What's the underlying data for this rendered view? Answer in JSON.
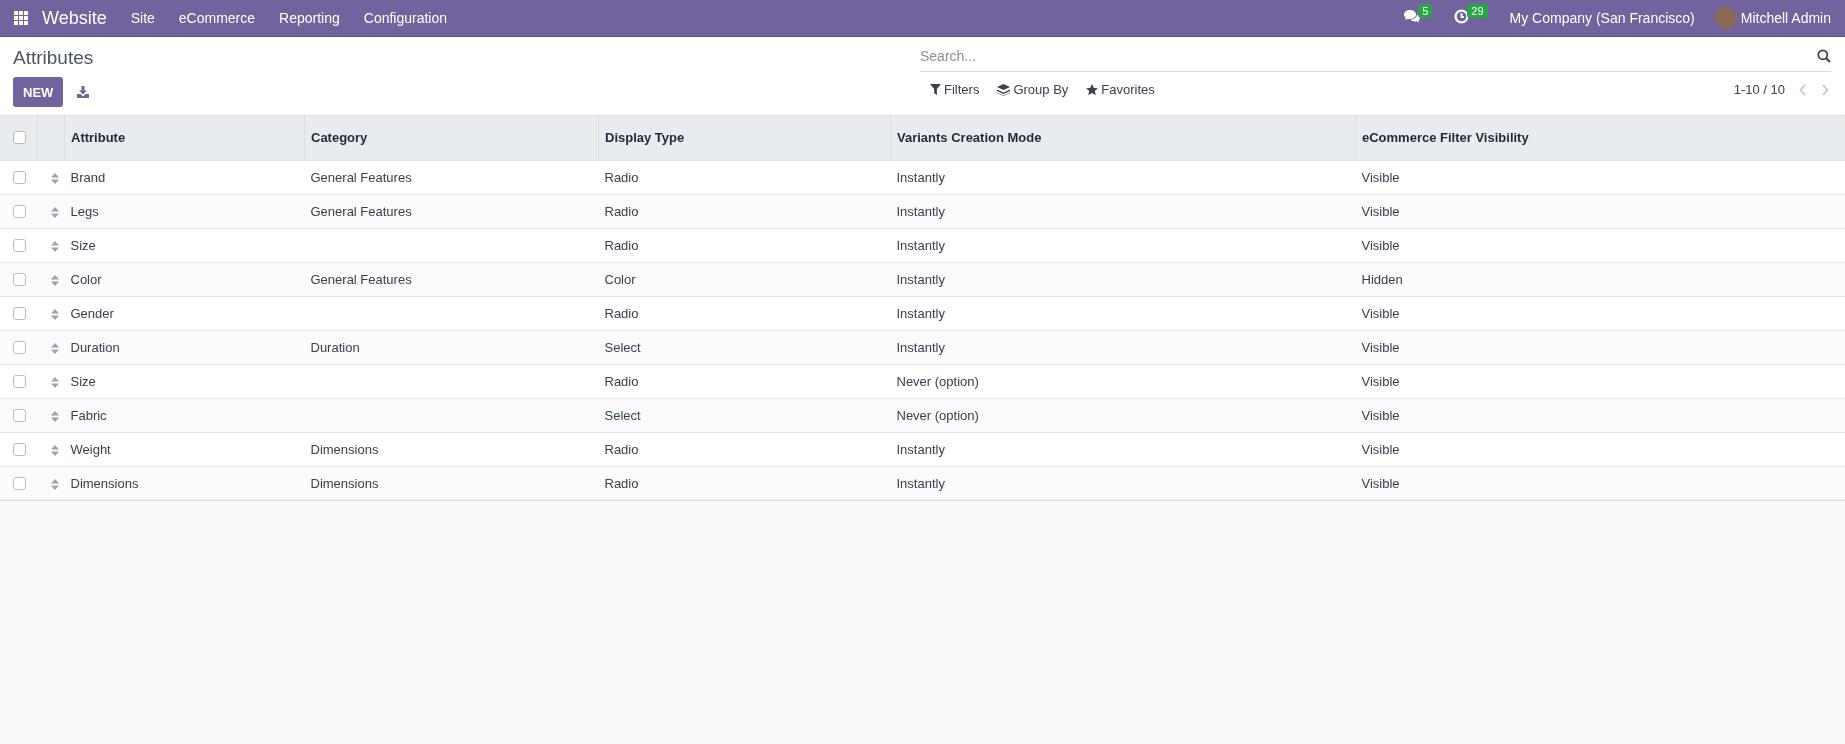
{
  "navbar": {
    "app_name": "Website",
    "menu": [
      "Site",
      "eCommerce",
      "Reporting",
      "Configuration"
    ],
    "messages_count": "5",
    "activities_count": "29",
    "company": "My Company (San Francisco)",
    "user": "Mitchell Admin"
  },
  "control_panel": {
    "title": "Attributes",
    "new_button": "NEW",
    "search": {
      "placeholder": "Search..."
    },
    "filters": [
      {
        "kind": "filter",
        "label": "Filters"
      },
      {
        "kind": "group",
        "label": "Group By"
      },
      {
        "kind": "favorite",
        "label": "Favorites"
      }
    ],
    "pager": "1-10 / 10"
  },
  "table": {
    "select_all": {
      "checked": false
    },
    "columns": [
      "Attribute",
      "Category",
      "Display Type",
      "Variants Creation Mode",
      "eCommerce Filter Visibility"
    ],
    "rows": [
      {
        "checked": false,
        "cells": [
          "Brand",
          "General Features",
          "Radio",
          "Instantly",
          "Visible"
        ]
      },
      {
        "checked": false,
        "cells": [
          "Legs",
          "General Features",
          "Radio",
          "Instantly",
          "Visible"
        ]
      },
      {
        "checked": false,
        "cells": [
          "Size",
          "",
          "Radio",
          "Instantly",
          "Visible"
        ]
      },
      {
        "checked": false,
        "cells": [
          "Color",
          "General Features",
          "Color",
          "Instantly",
          "Hidden"
        ]
      },
      {
        "checked": false,
        "cells": [
          "Gender",
          "",
          "Radio",
          "Instantly",
          "Visible"
        ]
      },
      {
        "checked": false,
        "cells": [
          "Duration",
          "Duration",
          "Select",
          "Instantly",
          "Visible"
        ]
      },
      {
        "checked": false,
        "cells": [
          "Size",
          "",
          "Radio",
          "Never (option)",
          "Visible"
        ]
      },
      {
        "checked": false,
        "cells": [
          "Fabric",
          "",
          "Select",
          "Never (option)",
          "Visible"
        ]
      },
      {
        "checked": false,
        "cells": [
          "Weight",
          "Dimensions",
          "Radio",
          "Instantly",
          "Visible"
        ]
      },
      {
        "checked": false,
        "cells": [
          "Dimensions",
          "Dimensions",
          "Radio",
          "Instantly",
          "Visible"
        ]
      }
    ]
  }
}
